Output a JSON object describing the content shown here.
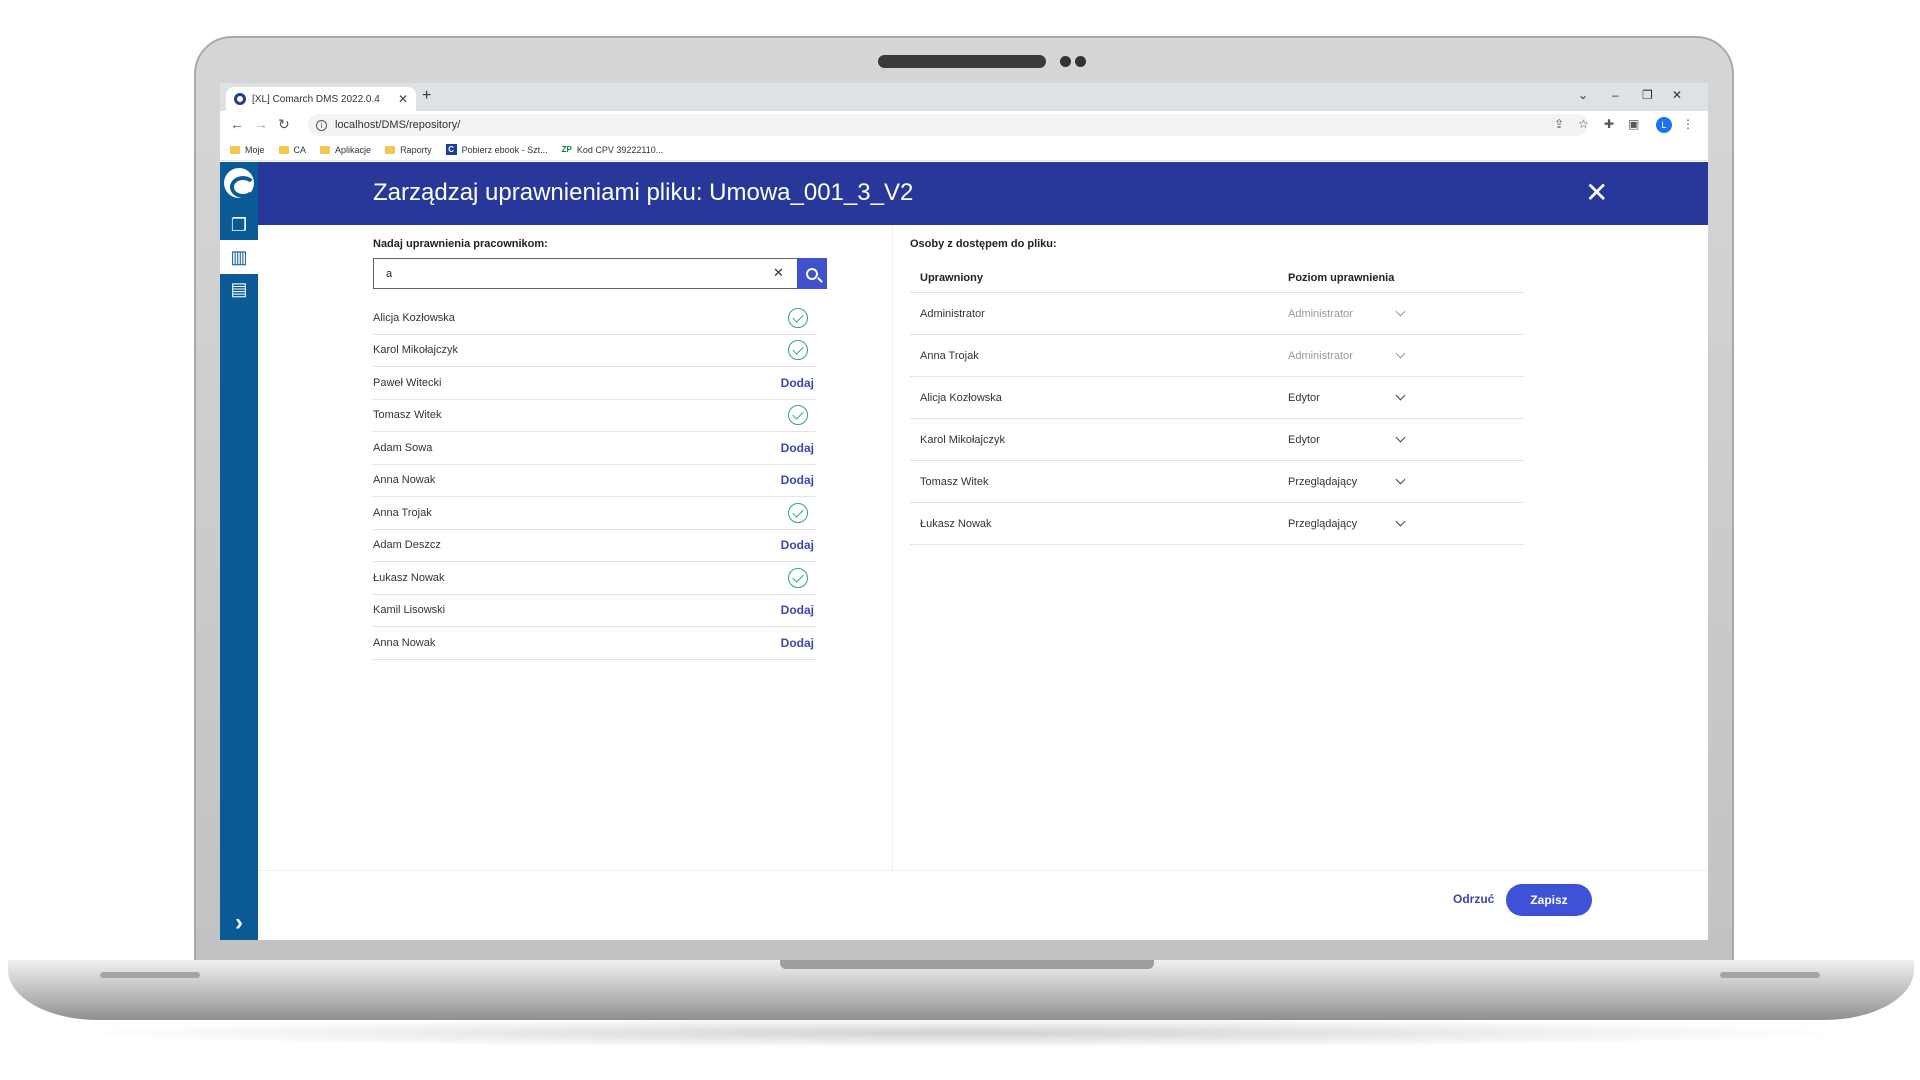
{
  "browser": {
    "tab_title": "[XL] Comarch DMS 2022.0.4",
    "new_tab": "+",
    "url": "localhost/DMS/repository/",
    "bookmarks": [
      {
        "label": "Moje",
        "type": "folder"
      },
      {
        "label": "CA",
        "type": "folder"
      },
      {
        "label": "Aplikacje",
        "type": "folder"
      },
      {
        "label": "Raporty",
        "type": "folder"
      },
      {
        "label": "Pobierz ebook - Szt...",
        "type": "site-c"
      },
      {
        "label": "Kod CPV 39222110...",
        "type": "site-zp"
      }
    ],
    "profile_initial": "L"
  },
  "modal": {
    "title": "Zarządzaj uprawnieniami pliku: Umowa_001_3_V2",
    "left": {
      "label": "Nadaj uprawnienia pracownikom:",
      "search_value": "a",
      "users": [
        {
          "name": "Alicja Kozłowska",
          "status": "added"
        },
        {
          "name": "Karol Mikołajczyk",
          "status": "added"
        },
        {
          "name": "Paweł Witecki",
          "status": "add",
          "action": "Dodaj"
        },
        {
          "name": "Tomasz Witek",
          "status": "added"
        },
        {
          "name": "Adam Sowa",
          "status": "add",
          "action": "Dodaj"
        },
        {
          "name": "Anna Nowak",
          "status": "add",
          "action": "Dodaj"
        },
        {
          "name": "Anna Trojak",
          "status": "added"
        },
        {
          "name": "Adam Deszcz",
          "status": "add",
          "action": "Dodaj"
        },
        {
          "name": "Łukasz Nowak",
          "status": "added"
        },
        {
          "name": "Kamil Lisowski",
          "status": "add",
          "action": "Dodaj"
        },
        {
          "name": "Anna Nowak",
          "status": "add",
          "action": "Dodaj"
        }
      ]
    },
    "right": {
      "label": "Osoby z dostępem do pliku:",
      "col_user": "Uprawniony",
      "col_level": "Poziom uprawnienia",
      "rows": [
        {
          "user": "Administrator",
          "level": "Administrator",
          "disabled": true
        },
        {
          "user": "Anna Trojak",
          "level": "Administrator",
          "disabled": true
        },
        {
          "user": "Alicja Kozłowska",
          "level": "Edytor",
          "disabled": false
        },
        {
          "user": "Karol Mikołajczyk",
          "level": "Edytor",
          "disabled": false
        },
        {
          "user": "Tomasz Witek",
          "level": "Przeglądający",
          "disabled": false
        },
        {
          "user": "Łukasz Nowak",
          "level": "Przeglądający",
          "disabled": false
        }
      ]
    },
    "footer": {
      "cancel_label": "Odrzuć",
      "save_label": "Zapisz"
    }
  },
  "colors": {
    "header_bg": "#27389a",
    "sidebar_bg": "#0a5a96",
    "accent": "#3f51d6",
    "check": "#2aa876"
  }
}
